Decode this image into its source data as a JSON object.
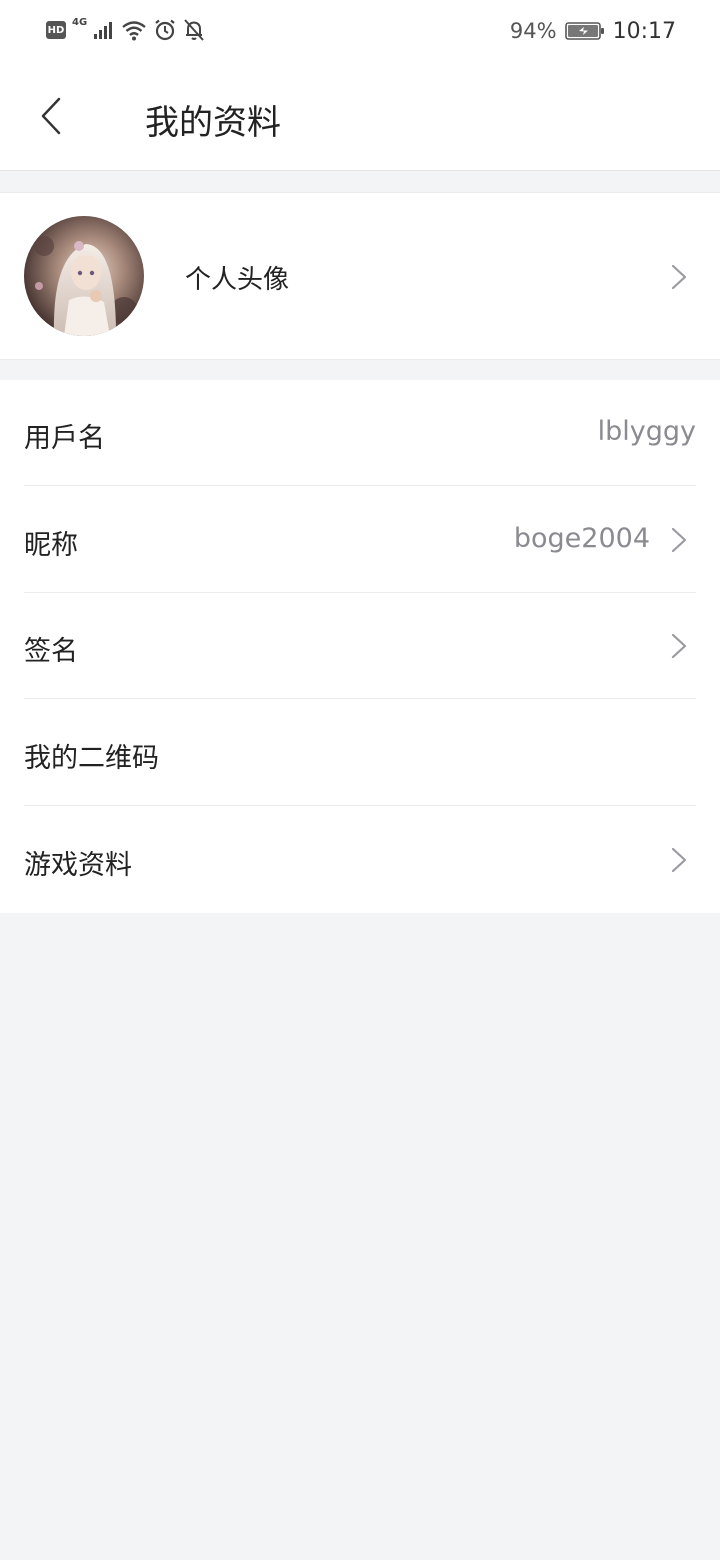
{
  "status_bar": {
    "left_icons": [
      "hd-badge",
      "4g-signal-icon",
      "wifi-icon",
      "alarm-icon",
      "bell-off-icon"
    ],
    "hd_label": "HD",
    "network_label": "4G",
    "battery_percent": "94%",
    "time": "10:17"
  },
  "header": {
    "title": "我的资料"
  },
  "avatar_section": {
    "label": "个人头像"
  },
  "rows": [
    {
      "label": "用戶名",
      "value": "lblyggy",
      "has_chevron": false
    },
    {
      "label": "昵称",
      "value": "boge2004",
      "has_chevron": true
    },
    {
      "label": "签名",
      "value": "",
      "has_chevron": true
    },
    {
      "label": "我的二维码",
      "value": "",
      "has_chevron": false
    },
    {
      "label": "游戏资料",
      "value": "",
      "has_chevron": true
    }
  ],
  "colors": {
    "page_background": "#f3f4f6",
    "card_background": "#ffffff",
    "primary_text": "#222222",
    "secondary_text": "#8a8a90",
    "chevron": "#9a9aa0"
  }
}
